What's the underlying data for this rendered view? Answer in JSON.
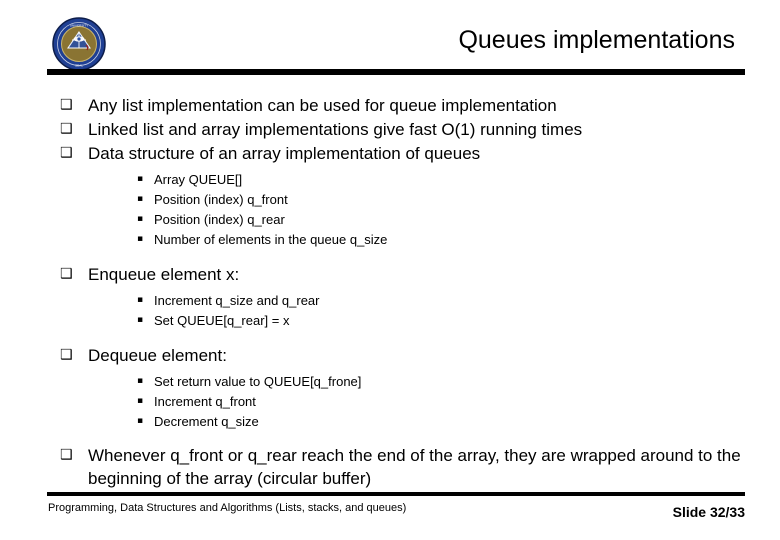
{
  "slide": {
    "title": "Queues implementations",
    "logo_alt": "university-seal-logo",
    "bullet_glyph_level1": "❑",
    "bullet_glyph_level2": "▪",
    "background_color": "#ffffff",
    "text_color": "#000000",
    "rule_color": "#000000",
    "logo_colors": {
      "ring": "#1f3f93",
      "ring_dark": "#12265c",
      "inner": "#8a7433",
      "inner_light": "#b09a50",
      "emblem": "#2a4fa0",
      "emblem_light": "#ffffff"
    }
  },
  "content": {
    "blocks": [
      {
        "level": 1,
        "text": "Any list implementation can be used for queue implementation"
      },
      {
        "level": 1,
        "text": "Linked list and array implementations give fast O(1) running times"
      },
      {
        "level": 1,
        "text": "Data structure of an array implementation of queues"
      },
      {
        "level": 2,
        "text": "Array QUEUE[]"
      },
      {
        "level": 2,
        "text": "Position (index) q_front"
      },
      {
        "level": 2,
        "text": "Position (index) q_rear"
      },
      {
        "level": 2,
        "text": "Number of elements in the queue q_size"
      },
      {
        "level": 1,
        "text": "Enqueue element x:"
      },
      {
        "level": 2,
        "text": "Increment q_size and q_rear"
      },
      {
        "level": 2,
        "text": "Set QUEUE[q_rear] = x"
      },
      {
        "level": 1,
        "text": "Dequeue element:"
      },
      {
        "level": 2,
        "text": "Set return value to QUEUE[q_frone]"
      },
      {
        "level": 2,
        "text": "Increment q_front"
      },
      {
        "level": 2,
        "text": "Decrement q_size"
      },
      {
        "level": 1,
        "text": "Whenever q_front or q_rear reach the end of the array, they are wrapped around to the beginning of the array (circular buffer)"
      }
    ]
  },
  "footer": {
    "course": "Programming, Data Structures and Algorithms  (Lists, stacks, and queues)",
    "slide_number": "Slide 32/33"
  }
}
